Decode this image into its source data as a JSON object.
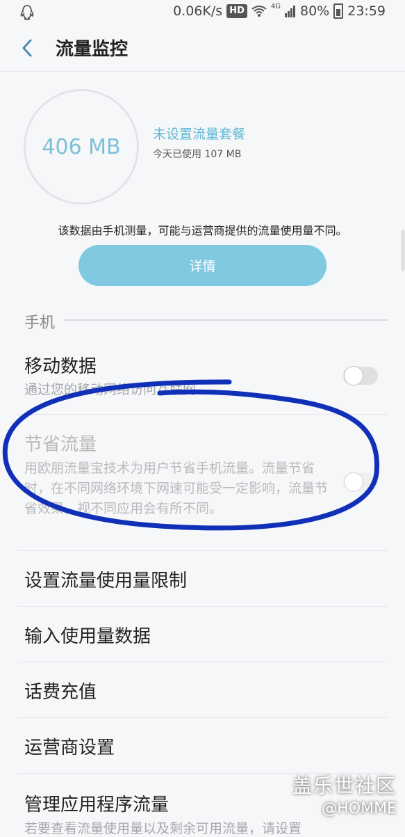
{
  "status": {
    "speed": "0.06K/s",
    "hd": "HD",
    "network": "4G",
    "battery": "80%",
    "time": "23:59"
  },
  "header": {
    "title": "流量监控"
  },
  "usage": {
    "total": "406 MB",
    "plan_link": "未设置流量套餐",
    "today": "今天已使用 107 MB",
    "disclaimer": "该数据由手机测量，可能与运营商提供的流量使用量不同。",
    "details_label": "详情"
  },
  "section": {
    "label": "手机"
  },
  "mobile_data": {
    "title": "移动数据",
    "subtitle": "通过您的移动网络访问互联网",
    "enabled": false
  },
  "data_saver": {
    "title": "节省流量",
    "subtitle": "用欧朋流量宝技术为用户节省手机流量。流量节省时，在不同网络环境下网速可能受一定影响，流量节省效果，视不同应用会有所不同。",
    "enabled": false
  },
  "menu": {
    "limit": "设置流量使用量限制",
    "input": "输入使用量数据",
    "recharge": "话费充值",
    "carrier": "运营商设置",
    "apps": "管理应用程序流量",
    "apps_sub": "若要查看流量使用量以及剩余可用流量，请设置"
  },
  "watermark": {
    "main": "盖乐世社区",
    "sub": "@HOMME"
  },
  "colors": {
    "accent": "#80c9e0",
    "annotation": "#1030b8"
  }
}
